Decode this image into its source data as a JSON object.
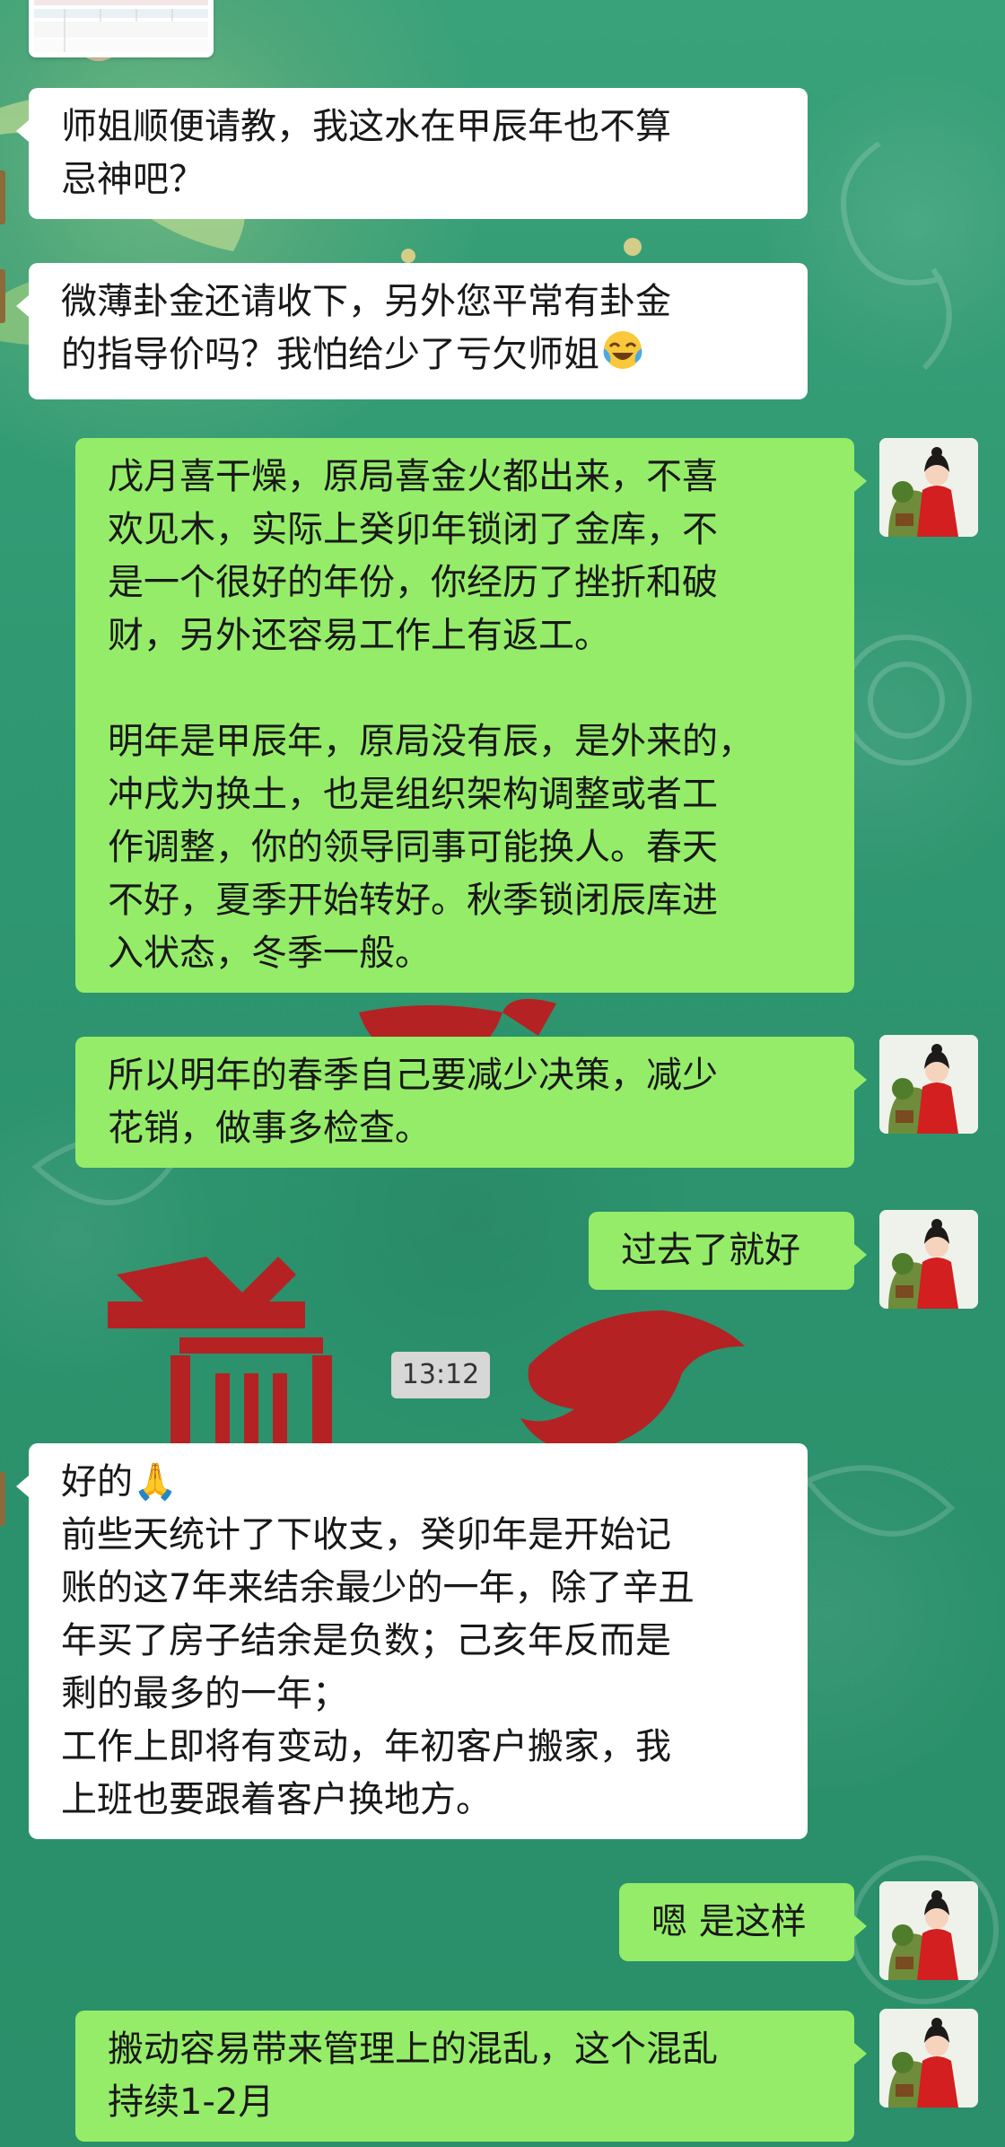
{
  "time_label": "13:12",
  "colors": {
    "background": "#2f9a74",
    "incoming_bubble": "#ffffff",
    "outgoing_bubble": "#95ec69",
    "time_pill": "#d7d7d7"
  },
  "messages": [
    {
      "side": "incoming",
      "lines": [
        "师姐顺便请教，我这水在甲辰年也不算",
        "忌神吧？"
      ]
    },
    {
      "side": "incoming",
      "lines": [
        "微薄卦金还请收下，另外您平常有卦金",
        "的指导价吗？我怕给少了亏欠师姐"
      ],
      "emoji": "crying-laughing-icon"
    },
    {
      "side": "outgoing",
      "lines": [
        "戊月喜干燥，原局喜金火都出来，不喜",
        "欢见木，实际上癸卯年锁闭了金库，不",
        "是一个很好的年份，你经历了挫折和破",
        "财，另外还容易工作上有返工。",
        "",
        "明年是甲辰年，原局没有辰，是外来的，",
        "冲戌为换土，也是组织架构调整或者工",
        "作调整，你的领导同事可能换人。春天",
        "不好，夏季开始转好。秋季锁闭辰库进",
        "入状态，冬季一般。"
      ]
    },
    {
      "side": "outgoing",
      "lines": [
        "所以明年的春季自己要减少决策，减少",
        "花销，做事多检查。"
      ]
    },
    {
      "side": "outgoing",
      "lines": [
        "过去了就好"
      ]
    },
    {
      "side": "incoming",
      "lines": [
        "好的🙏",
        "前些天统计了下收支，癸卯年是开始记",
        "账的这7年来结余最少的一年，除了辛丑",
        "年买了房子结余是负数；己亥年反而是",
        "剩的最多的一年；",
        "工作上即将有变动，年初客户搬家，我",
        "上班也要跟着客户换地方。"
      ]
    },
    {
      "side": "outgoing",
      "lines": [
        "嗯 是这样"
      ]
    },
    {
      "side": "outgoing",
      "lines": [
        "搬动容易带来管理上的混乱，这个混乱",
        "持续1-2月"
      ]
    }
  ]
}
